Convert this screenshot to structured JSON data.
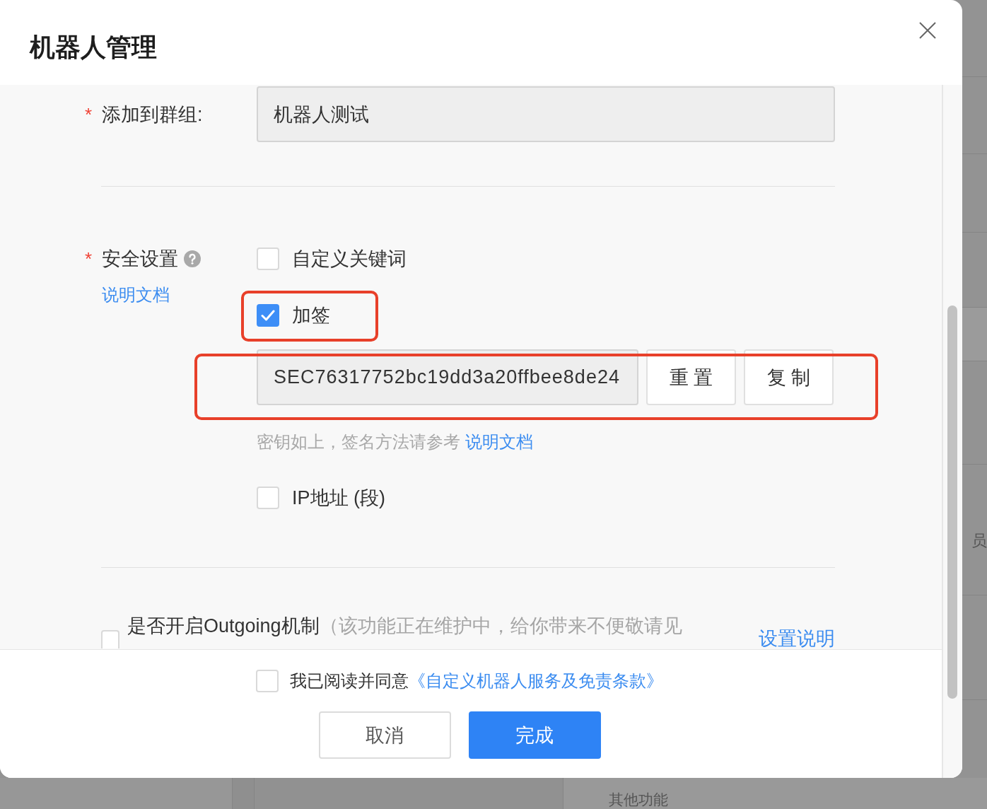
{
  "dialog": {
    "title": "机器人管理"
  },
  "form": {
    "group": {
      "mark": "*",
      "label": "添加到群组:",
      "value": "机器人测试"
    },
    "security": {
      "mark": "*",
      "label": "安全设置",
      "help_link": "说明文档",
      "options": [
        {
          "kind": "checkbox",
          "label": "自定义关键词",
          "checked": false,
          "highlighted": false
        },
        {
          "kind": "checkbox",
          "label": "加签",
          "checked": true,
          "highlighted": true
        },
        {
          "kind": "secret",
          "value": "SEC76317752bc19dd3a20ffbee8de24",
          "buttons": [
            "重 置",
            "复 制"
          ],
          "hint": "密钥如上，签名方法请参考",
          "hint_link": "说明文档",
          "highlighted": true
        },
        {
          "kind": "checkbox",
          "label": "IP地址 (段)",
          "checked": false,
          "highlighted": false
        }
      ]
    },
    "outgoing": {
      "checked": false,
      "label": "是否开启Outgoing机制",
      "note": "（该功能正在维护中，给你带来不便敬请见",
      "link": "设置说明"
    }
  },
  "footer": {
    "agreement": {
      "checked": false,
      "text": "我已阅读并同意",
      "link": "《自定义机器人服务及免责条款》"
    },
    "buttons": [
      {
        "kind": "secondary",
        "label": "取消"
      },
      {
        "kind": "primary",
        "label": "完成"
      }
    ]
  },
  "background": {
    "side_text": "员",
    "bottom_text": "其他功能"
  }
}
